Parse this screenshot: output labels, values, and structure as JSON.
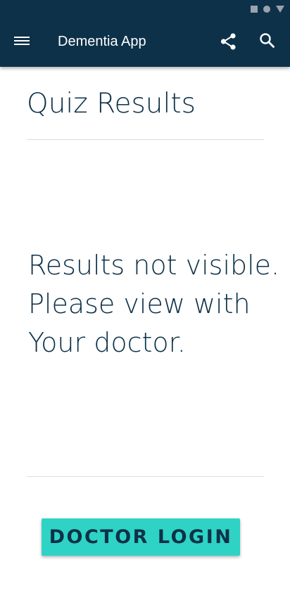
{
  "status_bar": {
    "icons": [
      "square-icon",
      "circle-icon",
      "triangle-icon"
    ],
    "icon_color": "#9aa3ab"
  },
  "app_bar": {
    "title": "Dementia App",
    "background": "#0d3148",
    "menu_icon": "hamburger-menu-icon",
    "share_icon": "share-icon",
    "search_icon": "search-icon"
  },
  "page": {
    "title": "Quiz Results",
    "message_lines": [
      "Results not visible.",
      "Please view with",
      "Your doctor."
    ],
    "text_color": "#0d3148"
  },
  "actions": {
    "doctor_login_label": "DOCTOR LOGIN",
    "button_color": "#2ed3c5"
  }
}
